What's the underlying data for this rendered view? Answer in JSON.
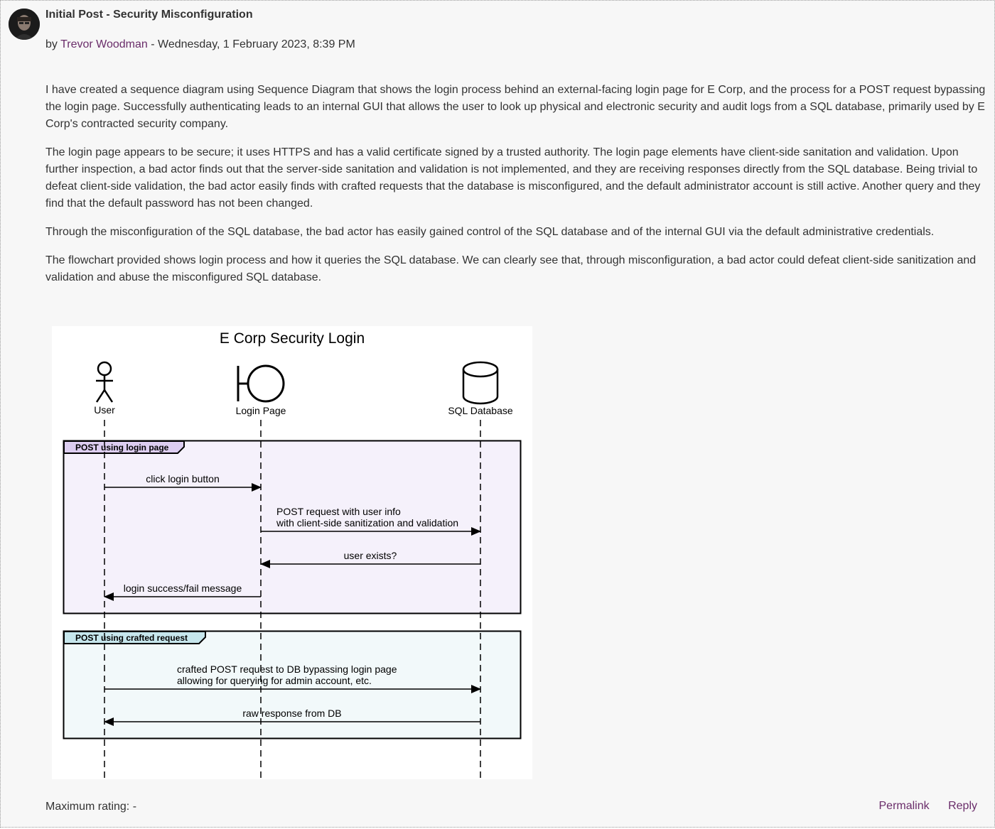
{
  "post": {
    "subject": "Initial Post - Security Misconfiguration",
    "byline_prefix": "by ",
    "author": "Trevor Woodman",
    "byline_suffix": " - Wednesday, 1 February 2023, 8:39 PM",
    "paragraphs": [
      "I have created a sequence diagram using Sequence Diagram that shows the login process behind an external-facing login page for E Corp, and the process for a POST request bypassing the login page. Successfully authenticating leads to an internal GUI that allows the user to look up physical and electronic security and audit logs from a SQL database, primarily used by E Corp's contracted security company.",
      "The login page appears to be secure; it uses HTTPS and has a valid certificate signed by a trusted authority. The login page elements have client-side sanitation and validation. Upon further inspection, a bad actor finds out that the server-side sanitation and validation is not implemented, and they are receiving responses directly from the SQL database. Being trivial to defeat client-side validation, the bad actor easily finds with crafted requests that the database is misconfigured, and the default administrator account is still active. Another query and they find that the default password has not been changed.",
      "Through the misconfiguration of the SQL database, the bad actor has easily gained control of the SQL database and of the internal GUI via the default administrative credentials.",
      "The flowchart provided shows login process and how it queries the SQL database. We can clearly see that, through misconfiguration, a bad actor could defeat client-side sanitization and validation and abuse the misconfigured SQL database."
    ],
    "rating_label": "Maximum rating: -",
    "commands": {
      "permalink": "Permalink",
      "reply": "Reply"
    }
  },
  "diagram": {
    "title": "E Corp Security Login",
    "participants": {
      "user": "User",
      "login_page": "Login Page",
      "sql_database": "SQL Database"
    },
    "groups": [
      {
        "label": "POST using login page",
        "color": "#f5f1fb",
        "tab_color": "#dccdf0",
        "messages": [
          {
            "line1": "click login button",
            "line2": ""
          },
          {
            "line1": "POST request with user info",
            "line2": "with client-side sanitization and validation"
          },
          {
            "line1": "user exists?",
            "line2": ""
          },
          {
            "line1": "login success/fail message",
            "line2": ""
          }
        ]
      },
      {
        "label": "POST using crafted request",
        "color": "#f2f9fa",
        "tab_color": "#c6e6ec",
        "messages": [
          {
            "line1": "crafted POST request to DB bypassing login page",
            "line2": "allowing for querying for admin account, etc."
          },
          {
            "line1": "raw response from DB",
            "line2": ""
          }
        ]
      }
    ]
  },
  "colors": {
    "text": "#333333",
    "link": "#6a2d6a",
    "page_bg": "#f7f7f7",
    "border": "#9a9a9a"
  }
}
